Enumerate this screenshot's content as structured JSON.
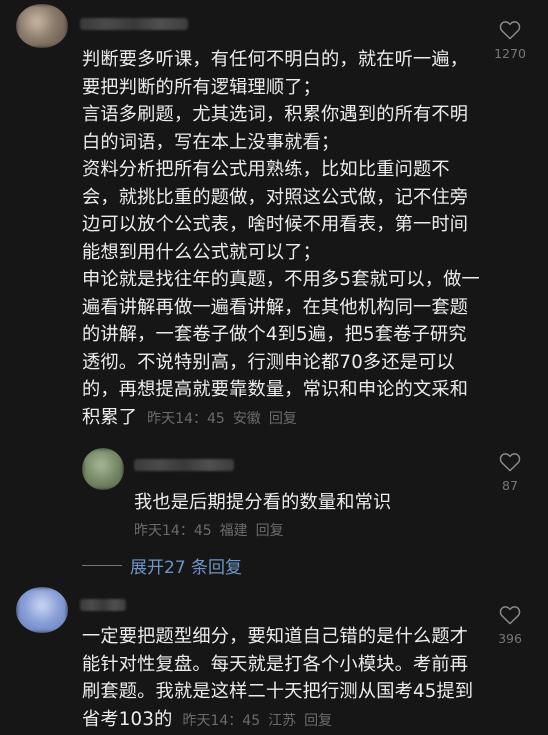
{
  "comments": [
    {
      "text": "判断要多听课，有任何不明白的，就在听一遍，要把判断的所有逻辑理顺了；\n言语多刷题，尤其选词，积累你遇到的所有不明白的词语，写在本上没事就看；\n资料分析把所有公式用熟练，比如比重问题不会，就挑比重的题做，对照这公式做，记不住旁边可以放个公式表，啥时候不用看表，第一时间能想到用什么公式就可以了；\n申论就是找往年的真题，不用多5套就可以，做一遍看讲解再做一遍看讲解，在其他机构同一套题的讲解，一套卷子做个4到5遍，把5套卷子研究透彻。不说特别高，行测申论都70多还是可以的，再想提高就要靠数量，常识和申论的文采和积累了",
      "time": "昨天14：45",
      "location": "安徽",
      "reply_label": "回复",
      "likes": "1270",
      "avatar_colors": [
        "#8a7a6a",
        "#c9b9a3",
        "#5e5146"
      ]
    },
    {
      "text": "我也是后期提分看的数量和常识",
      "time": "昨天14：45",
      "location": "福建",
      "reply_label": "回复",
      "likes": "87",
      "avatar_colors": [
        "#7a8d6a",
        "#a8b89a",
        "#4e5e47"
      ]
    },
    {
      "text": "一定要把题型细分，要知道自己错的是什么题才能针对性复盘。每天就是打各个小模块。考前再刷套题。我就是这样二十天把行测从国考45提到省考103的",
      "time": "昨天14：45",
      "location": "江苏",
      "reply_label": "回复",
      "likes": "396",
      "avatar_colors": [
        "#8aa0d8",
        "#cdd8f2",
        "#5f78b8"
      ]
    }
  ],
  "expand_replies": "展开27 条回复",
  "icons": {
    "like": "heart-outline-icon"
  },
  "colors": {
    "background": "#161616",
    "text": "#ececec",
    "meta": "#6b6b6b",
    "link": "#6f95c8"
  }
}
